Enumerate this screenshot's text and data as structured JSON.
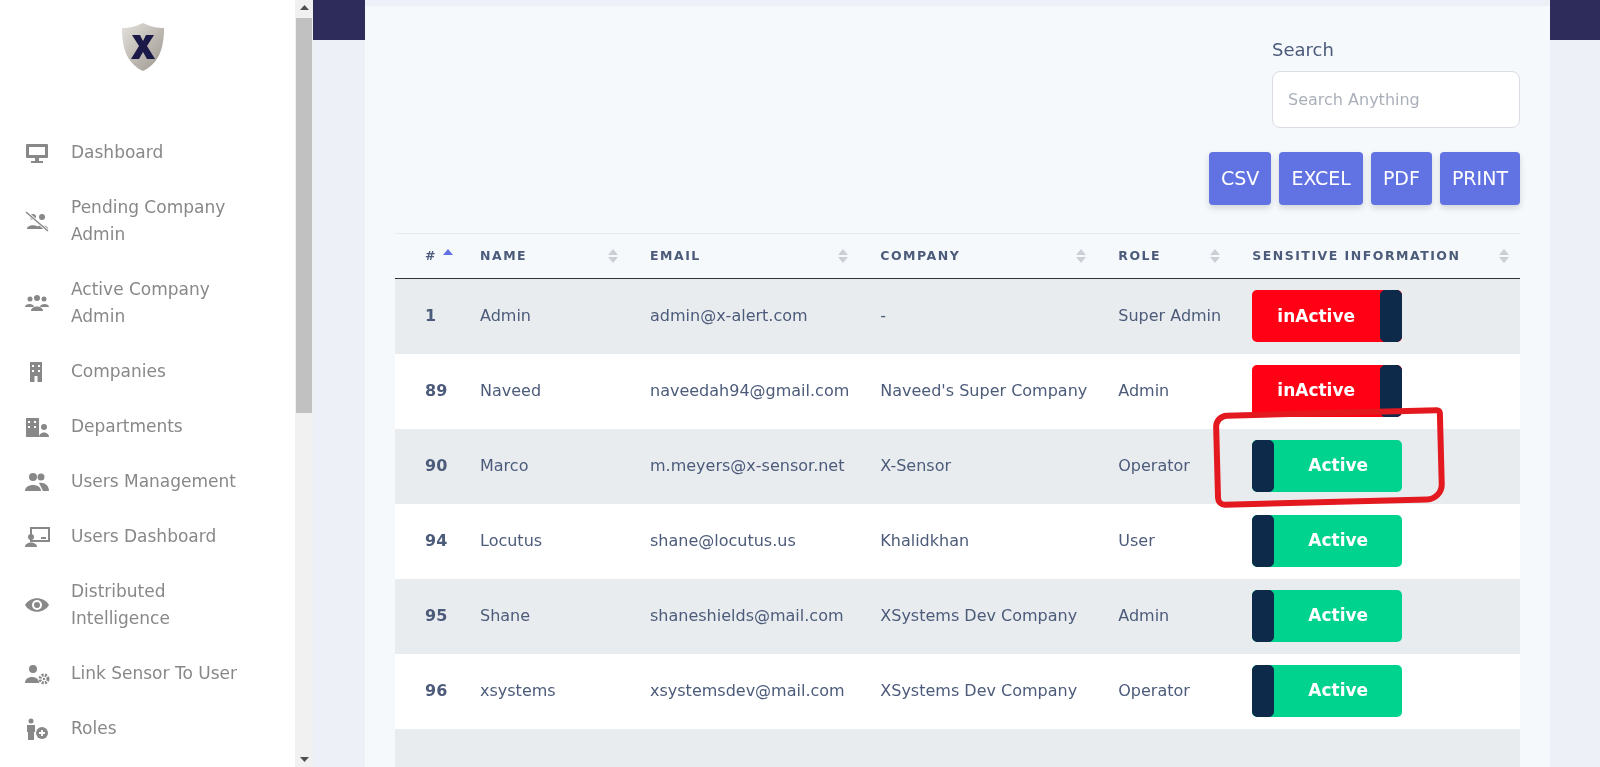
{
  "sidebar": {
    "items": [
      {
        "label": "Dashboard"
      },
      {
        "label": "Pending Company Admin"
      },
      {
        "label": "Active Company Admin"
      },
      {
        "label": "Companies"
      },
      {
        "label": "Departments"
      },
      {
        "label": "Users Management"
      },
      {
        "label": "Users Dashboard"
      },
      {
        "label": "Distributed Intelligence"
      },
      {
        "label": "Link Sensor To User"
      },
      {
        "label": "Roles"
      }
    ]
  },
  "search": {
    "label": "Search",
    "placeholder": "Search Anything"
  },
  "export_buttons": [
    "CSV",
    "EXCEL",
    "PDF",
    "PRINT"
  ],
  "table": {
    "columns": [
      {
        "label": "#",
        "sorted": true
      },
      {
        "label": "NAME",
        "sorted": false
      },
      {
        "label": "EMAIL",
        "sorted": false
      },
      {
        "label": "COMPANY",
        "sorted": false
      },
      {
        "label": "ROLE",
        "sorted": false
      },
      {
        "label": "SENSITIVE INFORMATION",
        "sorted": false
      }
    ],
    "rows": [
      {
        "id": "1",
        "name": "Admin",
        "email": "admin@x-alert.com",
        "company": "-",
        "role": "Super Admin",
        "status": "inActive",
        "active": false,
        "annotated": false
      },
      {
        "id": "89",
        "name": "Naveed",
        "email": "naveedah94@gmail.com",
        "company": "Naveed's Super Company",
        "role": "Admin",
        "status": "inActive",
        "active": false,
        "annotated": false
      },
      {
        "id": "90",
        "name": "Marco",
        "email": "m.meyers@x-sensor.net",
        "company": "X-Sensor",
        "role": "Operator",
        "status": "Active",
        "active": true,
        "annotated": true
      },
      {
        "id": "94",
        "name": "Locutus",
        "email": "shane@locutus.us",
        "company": "Khalidkhan",
        "role": "User",
        "status": "Active",
        "active": true,
        "annotated": false
      },
      {
        "id": "95",
        "name": "Shane",
        "email": "shaneshields@mail.com",
        "company": "XSystems Dev Company",
        "role": "Admin",
        "status": "Active",
        "active": true,
        "annotated": false
      },
      {
        "id": "96",
        "name": "xsystems",
        "email": "xsystemsdev@mail.com",
        "company": "XSystems Dev Company",
        "role": "Operator",
        "status": "Active",
        "active": true,
        "annotated": false
      }
    ]
  }
}
